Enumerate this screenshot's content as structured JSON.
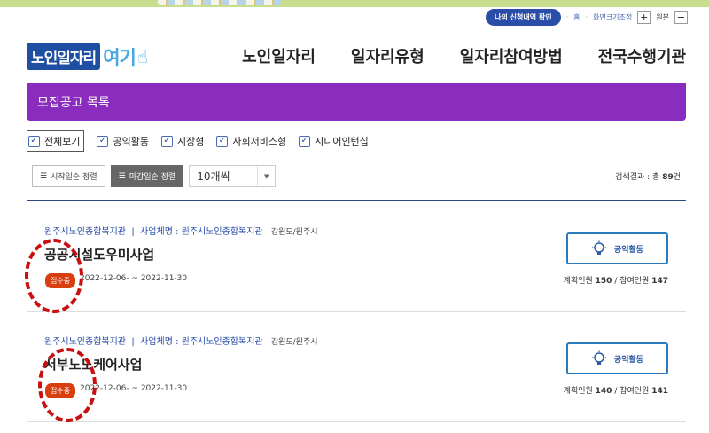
{
  "utility": {
    "apply_history": "나의 신청내역 확인",
    "home": "홈",
    "screen_size": "화면크기조정",
    "zoom_in": "+",
    "original": "원본",
    "zoom_out": "−"
  },
  "logo": {
    "part1": "노인일자리",
    "part2": "여기"
  },
  "nav": [
    {
      "label": "노인일자리"
    },
    {
      "label": "일자리유형"
    },
    {
      "label": "일자리참여방법"
    },
    {
      "label": "전국수행기관"
    }
  ],
  "banner": {
    "title": "모집공고 목록"
  },
  "filters": [
    {
      "label": "전체보기",
      "checked": true
    },
    {
      "label": "공익활동",
      "checked": true
    },
    {
      "label": "시장형",
      "checked": true
    },
    {
      "label": "사회서비스형",
      "checked": true
    },
    {
      "label": "시니어인턴십",
      "checked": true
    }
  ],
  "sort": {
    "start_label": "시작일순 정렬",
    "deadline_label": "마감일순 정렬",
    "page_size": "10개씩"
  },
  "result": {
    "label": "검색결과 : 총 ",
    "count": "89",
    "unit": "건"
  },
  "items": [
    {
      "org": "원주시노인종합복지관",
      "biz_label": "사업체명 : 원주시노인종합복지관",
      "region": "강원도/원주시",
      "title": "공공시설도우미사업",
      "status": "접수중",
      "dates": "2022-12-06- ~ 2022-11-30",
      "type": "공익활동",
      "planned_label": "계획인원 ",
      "planned": "150",
      "sep": " / ",
      "joined_label": "참여인원 ",
      "joined": "147"
    },
    {
      "org": "원주시노인종합복지관",
      "biz_label": "사업체명 : 원주시노인종합복지관",
      "region": "강원도/원주시",
      "title": "서부노노케어사업",
      "status": "접수중",
      "dates": "2022-12-06- ~ 2022-11-30",
      "type": "공익활동",
      "planned_label": "계획인원 ",
      "planned": "140",
      "sep": " / ",
      "joined_label": "참여인원 ",
      "joined": "141"
    }
  ],
  "colors": {
    "banner": "#8a2cbe",
    "status_badge": "#d83e0e",
    "annotation": "#c81010",
    "logo_blue": "#1f4fa2"
  }
}
